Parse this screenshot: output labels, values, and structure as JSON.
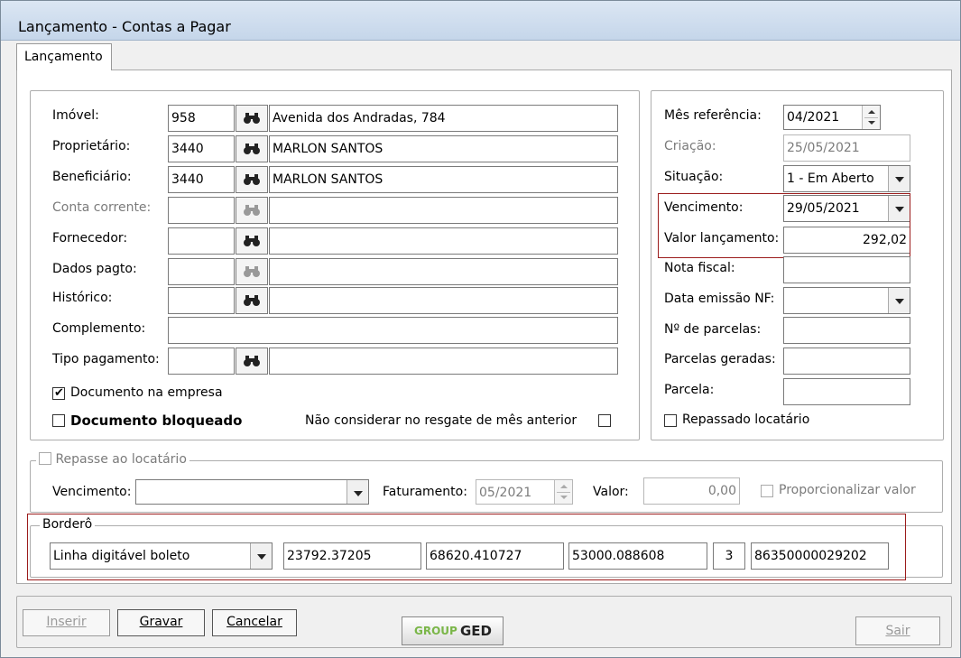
{
  "window": {
    "title": "Lançamento - Contas a Pagar"
  },
  "tabs": [
    {
      "label": "Lançamento"
    }
  ],
  "left_panel": {
    "imovel": {
      "label": "Imóvel:",
      "code": "958",
      "description": "Avenida dos Andradas, 784"
    },
    "proprietario": {
      "label": "Proprietário:",
      "code": "3440",
      "description": "MARLON SANTOS"
    },
    "beneficiario": {
      "label": "Beneficiário:",
      "code": "3440",
      "description": "MARLON SANTOS"
    },
    "conta_corrente": {
      "label": "Conta corrente:",
      "code": "",
      "description": ""
    },
    "fornecedor": {
      "label": "Fornecedor:",
      "code": "",
      "description": ""
    },
    "dados_pagto": {
      "label": "Dados pagto:",
      "code": "",
      "description": ""
    },
    "historico": {
      "label": "Histórico:",
      "code": "",
      "description": ""
    },
    "complemento": {
      "label": "Complemento:",
      "value": ""
    },
    "tipo_pagamento": {
      "label": "Tipo pagamento:",
      "code": "",
      "description": ""
    },
    "documento_empresa": {
      "label": "Documento na empresa",
      "checked": true
    },
    "documento_bloqueado": {
      "label": "Documento bloqueado",
      "checked": false
    },
    "nao_considerar": {
      "label": "Não considerar no resgate de mês anterior",
      "checked": false
    }
  },
  "right_panel": {
    "mes_referencia": {
      "label": "Mês referência:",
      "value": "04/2021"
    },
    "criacao": {
      "label": "Criação:",
      "value": "25/05/2021"
    },
    "situacao": {
      "label": "Situação:",
      "value": "1 - Em Aberto"
    },
    "vencimento": {
      "label": "Vencimento:",
      "value": "29/05/2021"
    },
    "valor_lancamento": {
      "label": "Valor lançamento:",
      "value": "292,02"
    },
    "nota_fiscal": {
      "label": "Nota fiscal:",
      "value": ""
    },
    "data_emissao_nf": {
      "label": "Data emissão NF:",
      "value": ""
    },
    "num_parcelas": {
      "label": "Nº de parcelas:",
      "value": ""
    },
    "parcelas_geradas": {
      "label": "Parcelas geradas:",
      "value": ""
    },
    "parcela": {
      "label": "Parcela:",
      "value": ""
    },
    "repassado_locatario": {
      "label": "Repassado locatário",
      "checked": false
    }
  },
  "repasse": {
    "label": "Repasse ao locatário",
    "checked": false,
    "vencimento_label": "Vencimento:",
    "vencimento_value": "",
    "faturamento_label": "Faturamento:",
    "faturamento_value": "05/2021",
    "valor_label": "Valor:",
    "valor_value": "0,00",
    "proporcionalizar_label": "Proporcionalizar valor"
  },
  "bordero": {
    "label": "Borderô",
    "type": "Linha digitável boleto",
    "fields": [
      "23792.37205",
      "68620.410727",
      "53000.088608",
      "3",
      "86350000029202"
    ]
  },
  "buttons": {
    "inserir": "Inserir",
    "gravar": "Gravar",
    "cancelar": "Cancelar",
    "sair": "Sair"
  },
  "logo": {
    "text_group": "GROUP",
    "text_ged": "GED"
  },
  "colors": {
    "highlight_red": "#9b1c1c",
    "logo_green": "#7ab648"
  }
}
